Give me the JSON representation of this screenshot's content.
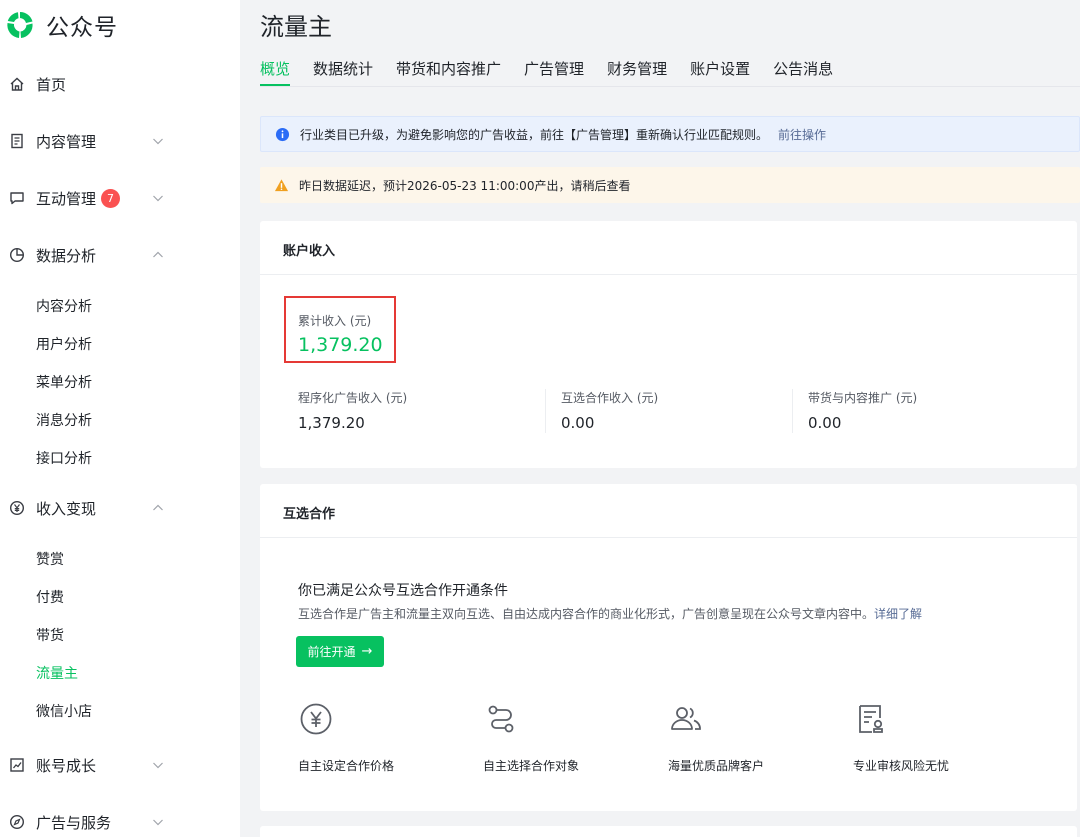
{
  "app": {
    "name": "公众号"
  },
  "sidebar": {
    "items": [
      {
        "label": "首页",
        "icon": "home-icon"
      },
      {
        "label": "内容管理",
        "icon": "document-icon"
      },
      {
        "label": "互动管理",
        "icon": "chat-icon",
        "badge": "7"
      },
      {
        "label": "数据分析",
        "icon": "pie-chart-icon"
      },
      {
        "label": "收入变现",
        "icon": "yen-icon"
      },
      {
        "label": "账号成长",
        "icon": "growth-chart-icon"
      },
      {
        "label": "广告与服务",
        "icon": "compass-icon"
      }
    ],
    "data_sub": [
      "内容分析",
      "用户分析",
      "菜单分析",
      "消息分析",
      "接口分析"
    ],
    "income_sub": [
      "赞赏",
      "付费",
      "带货",
      "流量主",
      "微信小店"
    ]
  },
  "page": {
    "title": "流量主",
    "tabs": [
      "概览",
      "数据统计",
      "带货和内容推广",
      "广告管理",
      "财务管理",
      "账户设置",
      "公告消息"
    ]
  },
  "notices": {
    "info_text": "行业类目已升级，为避免影响您的广告收益，前往【广告管理】重新确认行业匹配规则。",
    "info_link": "前往操作",
    "warn_text": "昨日数据延迟，预计2026-05-23 11:00:00产出，请稍后查看"
  },
  "income": {
    "title": "账户收入",
    "total_label": "累计收入 (元)",
    "total_value": "1,379.20",
    "stats": [
      {
        "label": "程序化广告收入 (元)",
        "value": "1,379.20"
      },
      {
        "label": "互选合作收入 (元)",
        "value": "0.00"
      },
      {
        "label": "带货与内容推广 (元)",
        "value": "0.00"
      }
    ]
  },
  "coop": {
    "title": "互选合作",
    "heading": "你已满足公众号互选合作开通条件",
    "desc": "互选合作是广告主和流量主双向互选、自由达成内容合作的商业化形式，广告创意呈现在公众号文章内容中。",
    "desc_link": "详细了解",
    "button": "前往开通",
    "features": [
      {
        "label": "自主设定合作价格",
        "icon": "yen-circle-icon"
      },
      {
        "label": "自主选择合作对象",
        "icon": "route-icon"
      },
      {
        "label": "海量优质品牌客户",
        "icon": "users-icon"
      },
      {
        "label": "专业审核风险无忧",
        "icon": "review-doc-icon"
      }
    ]
  },
  "colors": {
    "accent": "#07c160",
    "badge": "#fa5151",
    "link": "#576b95",
    "highlight": "#e53935"
  }
}
